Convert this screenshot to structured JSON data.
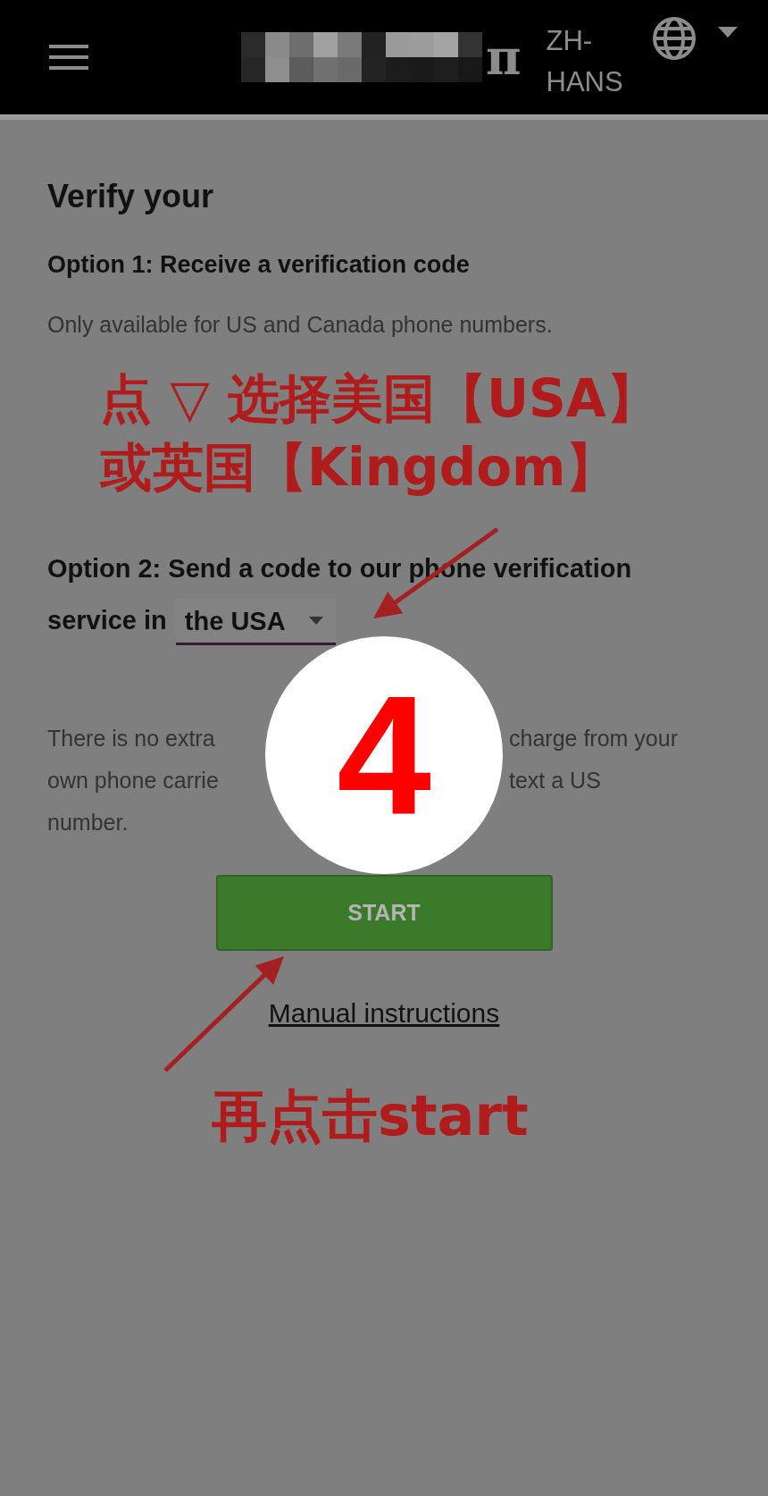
{
  "top_bar": {
    "logo_fragment": "π",
    "language": "ZH-HANS"
  },
  "title": "Verify your",
  "option1": {
    "heading": "Option 1: Receive a verification code",
    "note": "Only available for US and Canada phone numbers."
  },
  "option2": {
    "label_lines": [
      "Option 2: Send a code to our phone verification",
      "service in"
    ],
    "country_select": {
      "value": "the USA"
    }
  },
  "notice_lines": [
    {
      "left": "There is no extra",
      "right": "charge from your"
    },
    {
      "left": "own phone carrie",
      "right": "text a US"
    },
    {
      "left": "number."
    }
  ],
  "start_button": "START",
  "manual_link": "Manual instructions",
  "annotations": {
    "select_hint": [
      "点 ▽ 选择美国【USA】",
      "或英国【Kingdom】"
    ],
    "step_badge": "4",
    "start_hint": "再点击start"
  }
}
